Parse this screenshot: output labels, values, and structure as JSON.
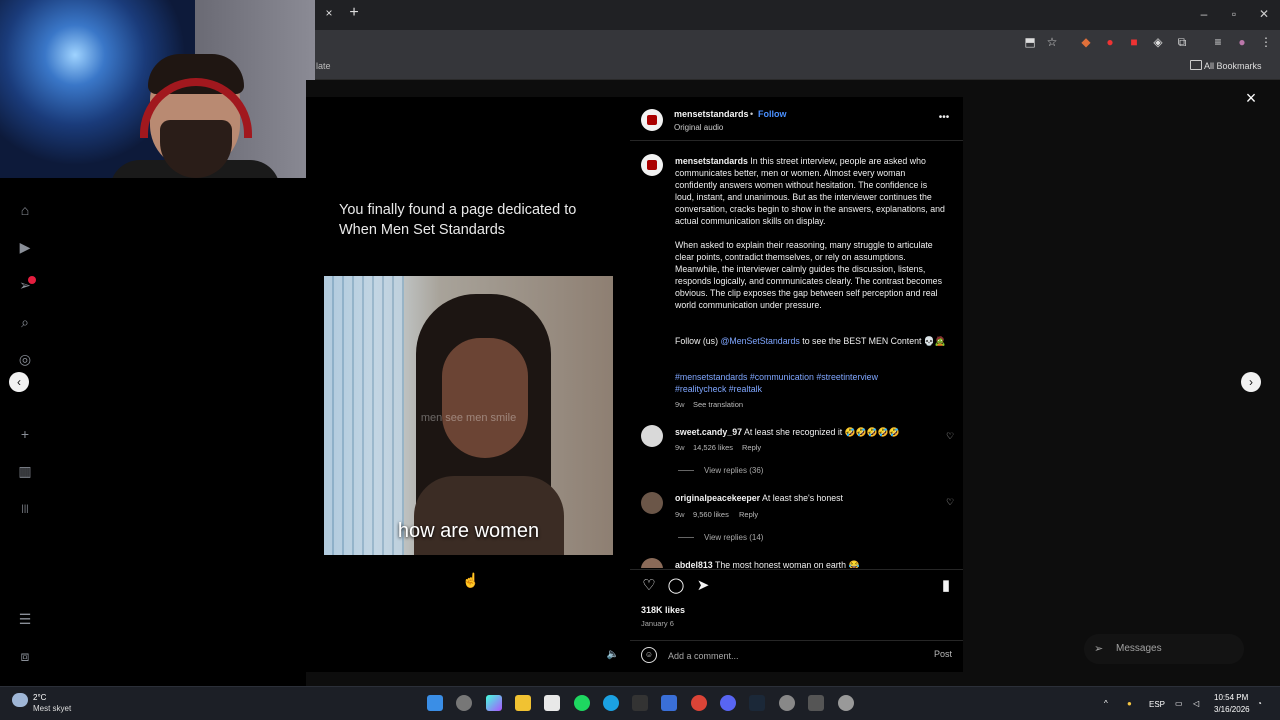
{
  "browser": {
    "tab_close": "×",
    "new_tab": "+",
    "bookmarks_left": "late",
    "all_bookmarks": "All Bookmarks"
  },
  "media": {
    "caption": "You finally found a page dedicated to When Men Set Standards",
    "watermark": "men see men smile",
    "subtitle": "how are women"
  },
  "post": {
    "username": "mensetstandards",
    "dot": "•",
    "follow": "Follow",
    "audio": "Original audio",
    "caption_p1": "In this street interview, people are asked who communicates better, men or women. Almost every woman confidently answers women without hesitation. The confidence is loud, instant, and unanimous. But as the interviewer continues the conversation, cracks begin to show in the answers, explanations, and actual communication skills on display.",
    "caption_p2": "When asked to explain their reasoning, many struggle to articulate clear points, contradict themselves, or rely on assumptions. Meanwhile, the interviewer calmly guides the discussion, listens, responds logically, and communicates clearly. The contrast becomes obvious. The clip exposes the gap between self perception and real world communication under pressure.",
    "follow_prefix": "Follow (us)",
    "follow_mention": "@MenSetStandards",
    "follow_suffix": "to see the BEST MEN Content 💀🧟",
    "hashtags": "#mensetstandards #communication #streetinterview #realitycheck #realtalk",
    "caption_age": "9w",
    "see_translation": "See translation",
    "likes": "318K likes",
    "date": "January 6",
    "comment_placeholder": "Add a comment...",
    "post_button": "Post"
  },
  "comments": [
    {
      "user": "sweet.candy_97",
      "text": "At least she recognized it 🤣🤣🤣🤣🤣",
      "age": "9w",
      "likes": "14,526 likes",
      "reply": "Reply",
      "view_replies": "View replies (36)"
    },
    {
      "user": "originalpeacekeeper",
      "text": "At least she's honest",
      "age": "9w",
      "likes": "9,560 likes",
      "reply": "Reply",
      "view_replies": "View replies (14)"
    },
    {
      "user": "abdel813",
      "text": "The most honest woman on earth 😂"
    }
  ],
  "messages": {
    "label": "Messages"
  },
  "taskbar": {
    "temp": "2°C",
    "weather": "Mest skyet",
    "lang": "ESP",
    "time": "10:54 PM",
    "date": "3/16/2026"
  },
  "icons": {
    "close": "×",
    "more": "•••",
    "heart": "♡",
    "comment": "◯",
    "share": "➤",
    "bookmark": "▮",
    "mute": "🔈",
    "left_arrow": "‹",
    "right_arrow": "›"
  }
}
